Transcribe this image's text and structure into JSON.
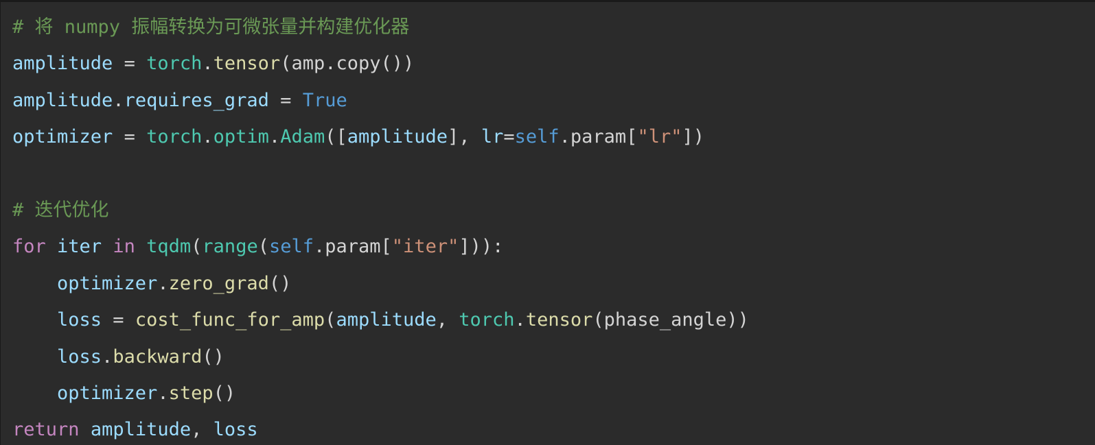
{
  "theme": {
    "background": "#2b2b2b",
    "token_colors": {
      "comment": "#6a9955",
      "variable": "#9cdcfe",
      "module": "#4ec9b0",
      "function": "#dcdcaa",
      "keyword_blue": "#569cd6",
      "keyword_control": "#c586c0",
      "string": "#ce9178",
      "plain": "#d4d4d4"
    }
  },
  "lines": [
    {
      "indent": 0,
      "tokens": [
        {
          "t": "# 将 numpy 振幅转换为可微张量并构建优化器",
          "c": "comment"
        }
      ]
    },
    {
      "indent": 0,
      "tokens": [
        {
          "t": "amplitude",
          "c": "variable"
        },
        {
          "t": " = ",
          "c": "plain"
        },
        {
          "t": "torch",
          "c": "module"
        },
        {
          "t": ".",
          "c": "plain"
        },
        {
          "t": "tensor",
          "c": "function"
        },
        {
          "t": "(amp.copy())",
          "c": "plain"
        }
      ]
    },
    {
      "indent": 0,
      "tokens": [
        {
          "t": "amplitude",
          "c": "variable"
        },
        {
          "t": ".",
          "c": "plain"
        },
        {
          "t": "requires_grad",
          "c": "variable"
        },
        {
          "t": " = ",
          "c": "plain"
        },
        {
          "t": "True",
          "c": "keyword_blue"
        }
      ]
    },
    {
      "indent": 0,
      "tokens": [
        {
          "t": "optimizer",
          "c": "variable"
        },
        {
          "t": " = ",
          "c": "plain"
        },
        {
          "t": "torch",
          "c": "module"
        },
        {
          "t": ".",
          "c": "plain"
        },
        {
          "t": "optim",
          "c": "module"
        },
        {
          "t": ".",
          "c": "plain"
        },
        {
          "t": "Adam",
          "c": "module"
        },
        {
          "t": "([",
          "c": "plain"
        },
        {
          "t": "amplitude",
          "c": "variable"
        },
        {
          "t": "], ",
          "c": "plain"
        },
        {
          "t": "lr",
          "c": "variable"
        },
        {
          "t": "=",
          "c": "plain"
        },
        {
          "t": "self",
          "c": "keyword_blue"
        },
        {
          "t": ".param[",
          "c": "plain"
        },
        {
          "t": "\"lr\"",
          "c": "string"
        },
        {
          "t": "])",
          "c": "plain"
        }
      ]
    },
    {
      "indent": 0,
      "tokens": []
    },
    {
      "indent": 0,
      "tokens": [
        {
          "t": "# 迭代优化",
          "c": "comment"
        }
      ]
    },
    {
      "indent": 0,
      "tokens": [
        {
          "t": "for",
          "c": "keyword_control"
        },
        {
          "t": " ",
          "c": "plain"
        },
        {
          "t": "iter",
          "c": "variable"
        },
        {
          "t": " ",
          "c": "plain"
        },
        {
          "t": "in",
          "c": "keyword_control"
        },
        {
          "t": " ",
          "c": "plain"
        },
        {
          "t": "tqdm",
          "c": "module"
        },
        {
          "t": "(",
          "c": "plain"
        },
        {
          "t": "range",
          "c": "module"
        },
        {
          "t": "(",
          "c": "plain"
        },
        {
          "t": "self",
          "c": "keyword_blue"
        },
        {
          "t": ".param[",
          "c": "plain"
        },
        {
          "t": "\"iter\"",
          "c": "string"
        },
        {
          "t": "])):",
          "c": "plain"
        }
      ]
    },
    {
      "indent": 1,
      "tokens": [
        {
          "t": "optimizer",
          "c": "variable"
        },
        {
          "t": ".",
          "c": "plain"
        },
        {
          "t": "zero_grad",
          "c": "function"
        },
        {
          "t": "()",
          "c": "plain"
        }
      ]
    },
    {
      "indent": 1,
      "tokens": [
        {
          "t": "loss",
          "c": "variable"
        },
        {
          "t": " = ",
          "c": "plain"
        },
        {
          "t": "cost_func_for_amp",
          "c": "function"
        },
        {
          "t": "(",
          "c": "plain"
        },
        {
          "t": "amplitude",
          "c": "variable"
        },
        {
          "t": ", ",
          "c": "plain"
        },
        {
          "t": "torch",
          "c": "module"
        },
        {
          "t": ".",
          "c": "plain"
        },
        {
          "t": "tensor",
          "c": "function"
        },
        {
          "t": "(phase_angle))",
          "c": "plain"
        }
      ]
    },
    {
      "indent": 1,
      "tokens": [
        {
          "t": "loss",
          "c": "variable"
        },
        {
          "t": ".",
          "c": "plain"
        },
        {
          "t": "backward",
          "c": "function"
        },
        {
          "t": "()",
          "c": "plain"
        }
      ]
    },
    {
      "indent": 1,
      "tokens": [
        {
          "t": "optimizer",
          "c": "variable"
        },
        {
          "t": ".",
          "c": "plain"
        },
        {
          "t": "step",
          "c": "function"
        },
        {
          "t": "()",
          "c": "plain"
        }
      ]
    },
    {
      "indent": 0,
      "tokens": [
        {
          "t": "return",
          "c": "keyword_control"
        },
        {
          "t": " ",
          "c": "plain"
        },
        {
          "t": "amplitude",
          "c": "variable"
        },
        {
          "t": ", ",
          "c": "plain"
        },
        {
          "t": "loss",
          "c": "variable"
        }
      ]
    }
  ]
}
